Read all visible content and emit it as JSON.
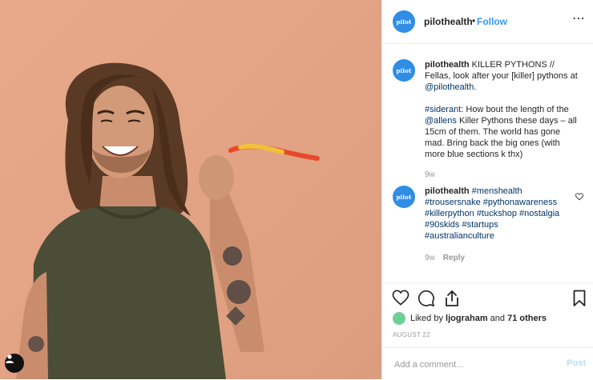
{
  "post": {
    "username": "pilothealth",
    "avatar_text": "pilot",
    "separator": "•",
    "follow_label": "Follow",
    "more_icon": "⋯",
    "caption": {
      "username": "pilothealth",
      "text1": " KILLER PYTHONS // Fellas, look after your [killer] pythons at ",
      "mention": "@pilothealth",
      "text2": ".",
      "hashtag": "#siderant",
      "text3": ": How bout the length of the ",
      "mention2": "@allens",
      "text4": " Killer Pythons these days – all 15cm of them. The world has gone mad. Bring back the big ones (with more blue sections k thx)",
      "age": "9w"
    },
    "comment": {
      "username": "pilothealth",
      "hashtags": "#menshealth #trousersnake #pythonawareness #killerpython #tuckshop #nostalgia #90skids #startups #australianculture",
      "age": "9w",
      "reply_label": "Reply"
    },
    "likes": {
      "prefix": "Liked by ",
      "user": "ljograham",
      "middle": " and ",
      "others": "71 others"
    },
    "date": "AUGUST 22",
    "add_comment_placeholder": "Add a comment...",
    "post_label": "Post"
  }
}
